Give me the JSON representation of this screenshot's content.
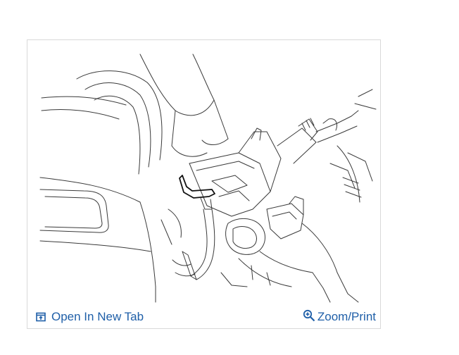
{
  "viewer": {
    "illustration_name": "steering-column-wiring-diagram",
    "open_new_tab_label": "Open In New Tab",
    "zoom_print_label": "Zoom/Print",
    "open_icon": "open-in-new-tab-icon",
    "zoom_icon": "zoom-in-icon",
    "accent_color": "#1f5fa8",
    "border_color": "#d9d9d9"
  }
}
